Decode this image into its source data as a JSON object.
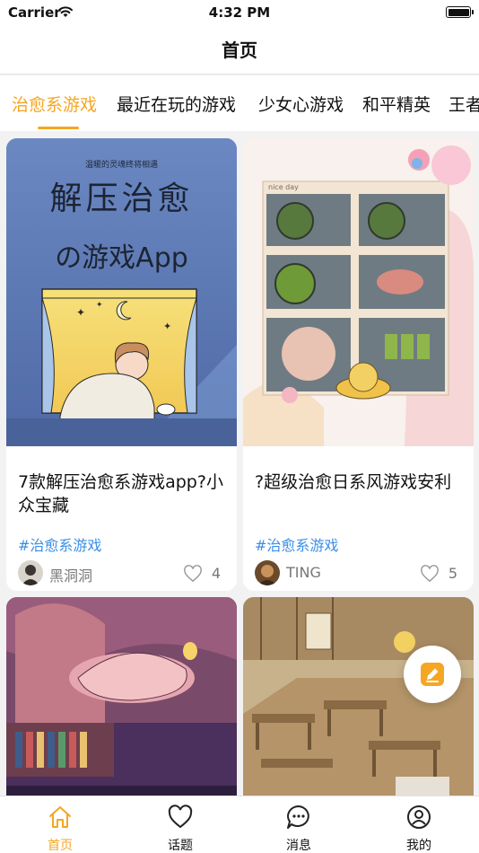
{
  "status_bar": {
    "carrier": "Carrier",
    "time": "4:32 PM"
  },
  "nav": {
    "title": "首页"
  },
  "tabs": [
    {
      "label": "治愈系游戏",
      "active": true
    },
    {
      "label": "最近在玩的游戏",
      "active": false
    },
    {
      "label": "少女心游戏",
      "active": false
    },
    {
      "label": "和平精英",
      "active": false
    },
    {
      "label": "王者",
      "active": false
    }
  ],
  "posts": [
    {
      "cover_text_small": "温暖的灵魂终将相遇",
      "cover_text_line1": "解压治愈",
      "cover_text_line2": "の游戏App",
      "title": "7款解压治愈系游戏app?小众宝藏",
      "tag": "#治愈系游戏",
      "author": "黑洞洞",
      "likes": "4"
    },
    {
      "cover_text_small": "nice day",
      "title": "?超级治愈日系风游戏安利",
      "tag": "#治愈系游戏",
      "author": "TING",
      "likes": "5"
    },
    {
      "cover_icon": "bedroom-illustration"
    },
    {
      "cover_icon": "restaurant-illustration"
    }
  ],
  "fab": {
    "icon": "edit-icon"
  },
  "tab_bar": [
    {
      "label": "首页",
      "icon": "home-icon",
      "active": true
    },
    {
      "label": "话题",
      "icon": "heart-icon",
      "active": false
    },
    {
      "label": "消息",
      "icon": "message-icon",
      "active": false
    },
    {
      "label": "我的",
      "icon": "profile-icon",
      "active": false
    }
  ],
  "colors": {
    "accent": "#f5a623",
    "tag": "#3b8ee6",
    "background": "#f2f2f2"
  }
}
